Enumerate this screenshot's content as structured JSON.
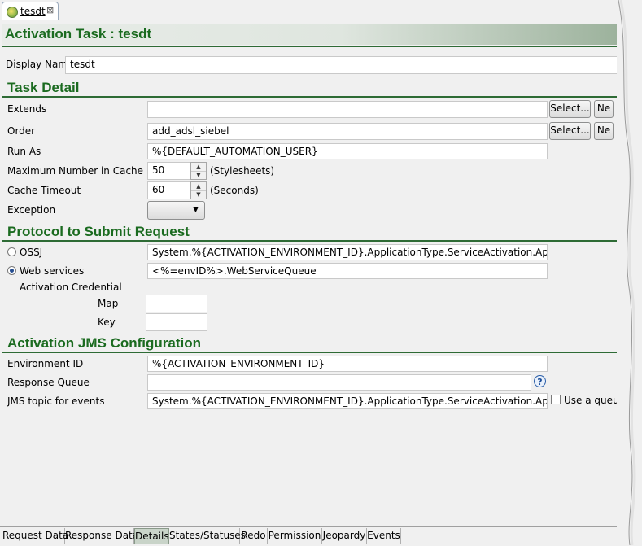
{
  "editor_tab": {
    "label": "tesdt",
    "close": "⊠",
    "icon": "task-icon"
  },
  "title": "Activation Task : tesdt",
  "display_name": {
    "label": "Display Name",
    "value": "tesdt"
  },
  "task_detail": {
    "heading": "Task Detail",
    "extends": {
      "label": "Extends",
      "value": "",
      "select": "Select...",
      "new": "Ne"
    },
    "order": {
      "label": "Order",
      "value": "add_adsl_siebel",
      "select": "Select...",
      "new": "Ne"
    },
    "run_as": {
      "label": "Run As",
      "value": "%{DEFAULT_AUTOMATION_USER}"
    },
    "max_cache": {
      "label": "Maximum Number in Cache",
      "value": "50",
      "unit": "(Stylesheets)"
    },
    "cache_timeout": {
      "label": "Cache Timeout",
      "value": "60",
      "unit": "(Seconds)"
    },
    "exception": {
      "label": "Exception",
      "value": ""
    }
  },
  "protocol": {
    "heading": "Protocol to Submit Request",
    "ossj": {
      "label": "OSSJ",
      "value": "System.%{ACTIVATION_ENVIRONMENT_ID}.ApplicationType.ServiceActivation.Application.",
      "selected": false
    },
    "web_services": {
      "label": "Web services",
      "value": "<%=envID%>.WebServiceQueue",
      "selected": true
    },
    "credential": {
      "label": "Activation Credential",
      "map_label": "Map",
      "map_value": "",
      "key_label": "Key",
      "key_value": ""
    }
  },
  "jms": {
    "heading": "Activation JMS Configuration",
    "environment_id": {
      "label": "Environment ID",
      "value": "%{ACTIVATION_ENVIRONMENT_ID}"
    },
    "response_queue": {
      "label": "Response Queue",
      "value": "",
      "help": "?"
    },
    "topic": {
      "label": "JMS topic for events",
      "value": "System.%{ACTIVATION_ENVIRONMENT_ID}.ApplicationType.ServiceActivation.Application.",
      "use_queue": "Use a queue"
    }
  },
  "bottom_tabs": [
    {
      "label": "Request Data"
    },
    {
      "label": "Response Data"
    },
    {
      "label": "Details"
    },
    {
      "label": "States/Statuses"
    },
    {
      "label": "Redo"
    },
    {
      "label": "Permission"
    },
    {
      "label": "Jeopardy"
    },
    {
      "label": "Events"
    }
  ],
  "active_bottom_tab": "Details",
  "colors": {
    "heading": "#1b6b20",
    "rule": "#2e6b35",
    "background": "#f0f0f0"
  }
}
